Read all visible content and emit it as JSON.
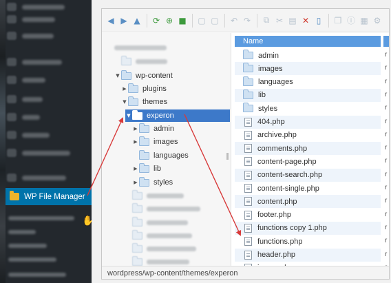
{
  "sidebar": {
    "active_item": "WP File Manager",
    "active_icon": "folder-icon"
  },
  "toolbar": {
    "buttons": [
      {
        "name": "back-button",
        "glyph": "◀"
      },
      {
        "name": "forward-button",
        "glyph": "▶"
      },
      {
        "name": "up-button",
        "glyph": "▲"
      },
      {
        "name": "reload-button",
        "glyph": "⟳"
      },
      {
        "name": "new-file-button",
        "glyph": "⊕"
      },
      {
        "name": "save-button",
        "glyph": "■"
      },
      {
        "name": "open-button",
        "glyph": "▢"
      },
      {
        "name": "edit-file-button",
        "glyph": "▢"
      },
      {
        "name": "undo-button",
        "glyph": "↶"
      },
      {
        "name": "redo-button",
        "glyph": "↷"
      },
      {
        "name": "copy-button",
        "glyph": "⧉"
      },
      {
        "name": "cut-button",
        "glyph": "✂"
      },
      {
        "name": "paste-button",
        "glyph": "▤"
      },
      {
        "name": "delete-button",
        "glyph": "✕"
      },
      {
        "name": "empty-button",
        "glyph": "▯"
      },
      {
        "name": "duplicate-button",
        "glyph": "❐"
      },
      {
        "name": "info-button",
        "glyph": "ⓘ"
      },
      {
        "name": "view-button",
        "glyph": "▦"
      },
      {
        "name": "settings-button",
        "glyph": "⚙"
      }
    ]
  },
  "tree": {
    "nodes": [
      {
        "label": "wp-content",
        "expanded": true
      },
      {
        "label": "plugins",
        "expanded": false
      },
      {
        "label": "themes",
        "expanded": true
      },
      {
        "label": "experon",
        "expanded": true,
        "selected": true
      },
      {
        "label": "admin",
        "expanded": false
      },
      {
        "label": "images",
        "expanded": false
      },
      {
        "label": "languages",
        "expanded": false
      },
      {
        "label": "lib",
        "expanded": false
      },
      {
        "label": "styles",
        "expanded": false
      }
    ]
  },
  "list": {
    "column_header": "Name",
    "items": [
      {
        "label": "admin",
        "kind": "folder"
      },
      {
        "label": "images",
        "kind": "folder"
      },
      {
        "label": "languages",
        "kind": "folder"
      },
      {
        "label": "lib",
        "kind": "folder"
      },
      {
        "label": "styles",
        "kind": "folder"
      },
      {
        "label": "404.php",
        "kind": "file"
      },
      {
        "label": "archive.php",
        "kind": "file"
      },
      {
        "label": "comments.php",
        "kind": "file"
      },
      {
        "label": "content-page.php",
        "kind": "file"
      },
      {
        "label": "content-search.php",
        "kind": "file"
      },
      {
        "label": "content-single.php",
        "kind": "file"
      },
      {
        "label": "content.php",
        "kind": "file"
      },
      {
        "label": "footer.php",
        "kind": "file"
      },
      {
        "label": "functions copy 1.php",
        "kind": "file"
      },
      {
        "label": "functions.php",
        "kind": "file"
      },
      {
        "label": "header.php",
        "kind": "file"
      },
      {
        "label": "image.php",
        "kind": "file"
      }
    ],
    "right_col_letter": "r"
  },
  "statusbar": {
    "path": "wordpress/wp-content/themes/experon"
  },
  "colors": {
    "selection": "#3d79c9",
    "header": "#5b9be0",
    "sidebar_active": "#0073aa",
    "annotation": "#d83a3a"
  }
}
